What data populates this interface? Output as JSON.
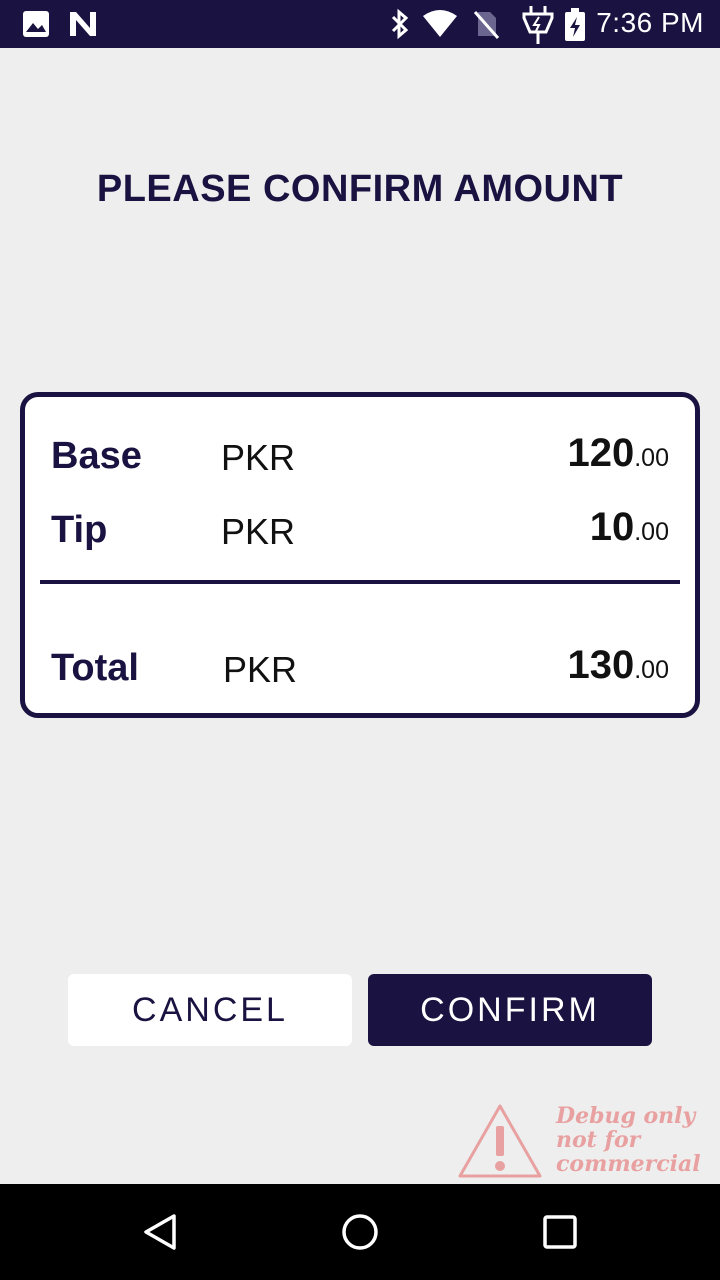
{
  "status_bar": {
    "time": "7:36 PM",
    "icons": [
      "image-icon",
      "n-app-icon",
      "bluetooth-icon",
      "wifi-icon",
      "no-sim-icon",
      "charging-plug-icon",
      "battery-charging-icon"
    ]
  },
  "page": {
    "title": "PLEASE CONFIRM AMOUNT"
  },
  "amount_card": {
    "rows": [
      {
        "label": "Base",
        "currency": "PKR",
        "whole": "120",
        "cents": ".00"
      },
      {
        "label": "Tip",
        "currency": "PKR",
        "whole": "10",
        "cents": ".00"
      }
    ],
    "total": {
      "label": "Total",
      "currency": "PKR",
      "whole": "130",
      "cents": ".00"
    }
  },
  "actions": {
    "cancel_label": "CANCEL",
    "confirm_label": "CONFIRM"
  },
  "watermark": {
    "lines": [
      "Debug only",
      "not for",
      "commercial"
    ],
    "icon": "warning-triangle-icon"
  },
  "nav_bar": {
    "icons": [
      "back-icon",
      "home-icon",
      "recents-icon"
    ]
  },
  "colors": {
    "primary": "#1a1240",
    "background": "#eeeeee",
    "card": "#ffffff",
    "watermark": "#e8a0a0"
  }
}
